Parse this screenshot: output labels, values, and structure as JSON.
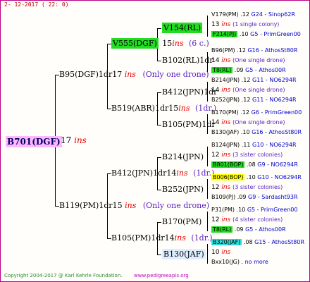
{
  "date": "2- 12-2017 ( 22: 0)",
  "footer": {
    "left": "Copyright 2004-2017 @ Karl Kehrle Foundation.",
    "right": "www.pedigreeapis.org"
  },
  "root": {
    "name": "B701(DGF)",
    "year": "17",
    "ins": "ins"
  },
  "g1": {
    "top": {
      "name": "B95(DGF)1dr",
      "year": "17",
      "ins": "ins",
      "note": "(Only one drone)"
    },
    "bottom": {
      "name": "B119(PM)1dr",
      "year": "15",
      "ins": "ins",
      "note": "(Only one drone)"
    }
  },
  "g2": {
    "a": {
      "name": "V555(DGF)",
      "year": "15",
      "ins": "ins",
      "note": "(6 c.)"
    },
    "b": {
      "name": "B519(ABR)1dr",
      "year": "15",
      "ins": "ins",
      "note": "(1dr.)"
    },
    "c": {
      "name": "B412(JPN)1dr",
      "year": "14",
      "ins": "ins",
      "note": "(1dr.)"
    },
    "d": {
      "name": "B105(PM)1dr",
      "year": "14",
      "ins": "ins",
      "note": "(1dr.)"
    }
  },
  "g3": {
    "a1": {
      "name": "V154(RL)"
    },
    "a2": {
      "name": "B102(RL)1dr"
    },
    "b1": {
      "name": "B412(JPN)1dr"
    },
    "b2": {
      "name": "B105(PM)1dr"
    },
    "c1": {
      "name": "B214(JPN)"
    },
    "c2": {
      "name": "B252(JPN)"
    },
    "d1": {
      "name": "B170(PM)"
    },
    "d2": {
      "name": "B130(JAF)"
    }
  },
  "g4": [
    {
      "a": "V179(PM)",
      "b": ".12",
      "c": "G24 - Sinop62R",
      "yr": "13",
      "ins": "ins",
      "note": "(1 single colony)",
      "d": "F214(PJ)",
      "e": ".10",
      "f": "G5 - PrimGreen00"
    },
    {
      "a": "B96(PM)",
      "b": ".12",
      "c": "G16 - AthosSt80R",
      "yr": "14",
      "ins": "ins",
      "note": "(One single drone)",
      "d": "T8(RL)",
      "e": ".09",
      "f": "G5 - Athos00R"
    },
    {
      "a": "B214(JPN)",
      "b": ".12",
      "c": "G11 - NO6294R",
      "yr": "14",
      "ins": "ins",
      "note": "(One single drone)",
      "d": "B252(JPN)",
      "e": ".12",
      "f": "G11 - NO6294R"
    },
    {
      "a": "B170(PM)",
      "b": ".12",
      "c": "G6 - PrimGreen00",
      "yr": "14",
      "ins": "ins",
      "note": "(One single drone)",
      "d": "B130(JAF)",
      "e": ".10",
      "f": "G16 - AthosSt80R"
    },
    {
      "a": "B124(JPN)",
      "b": ".11",
      "c": "G10 - NO6294R",
      "yr": "12",
      "ins": "ins",
      "note": "(3 sister colonies)",
      "d": "B801(BOP)",
      "e": ".08",
      "f": "G9 - NO6294R"
    },
    {
      "a": "B006(BOP)",
      "b": ".10",
      "c": "G10 - NO6294R",
      "yr": "12",
      "ins": "ins",
      "note": "(3 sister colonies)",
      "d": "B109(PJ)",
      "e": ".09",
      "f": "G9 - Sardasht93R"
    },
    {
      "a": "P31(PM)",
      "b": ".10",
      "c": "G5 - PrimGreen00",
      "yr": "12",
      "ins": "ins",
      "note": "(4 sister colonies)",
      "d": "T8(RL)",
      "e": ".09",
      "f": "G5 - Athos00R"
    },
    {
      "a": "B320(JAF)",
      "b": ".08",
      "c": "G15 - AthosSt80R",
      "yr": "10",
      "ins": "ins",
      "note": "",
      "d": "Bxx10(JG)",
      "e": ".",
      "f": "no more"
    }
  ]
}
